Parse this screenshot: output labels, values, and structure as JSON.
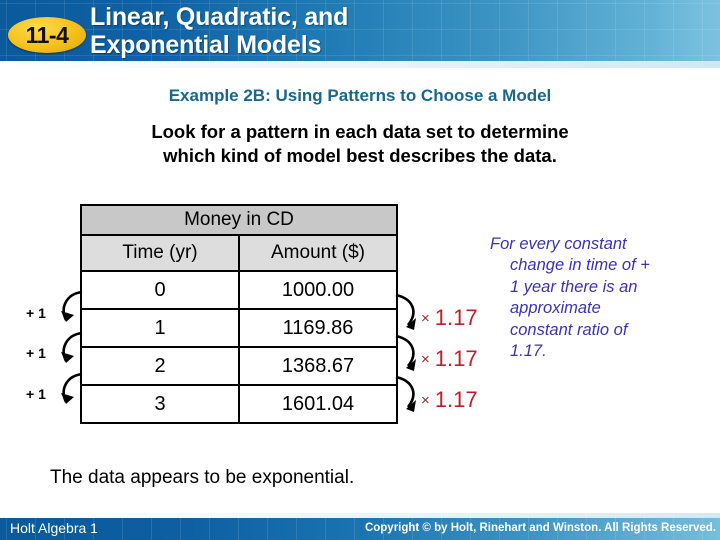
{
  "header": {
    "badge_label": "11-4",
    "title_line1": "Linear, Quadratic, and",
    "title_line2": "Exponential Models"
  },
  "example": {
    "heading": "Example 2B: Using Patterns to Choose a Model",
    "instruction_line1": "Look for a pattern in each data set to determine",
    "instruction_line2": "which kind of model best describes the data."
  },
  "table": {
    "title": "Money in CD",
    "columns": [
      "Time (yr)",
      "Amount ($)"
    ],
    "rows": [
      {
        "time": "0",
        "amount": "1000.00"
      },
      {
        "time": "1",
        "amount": "1169.86"
      },
      {
        "time": "2",
        "amount": "1368.67"
      },
      {
        "time": "3",
        "amount": "1601.04"
      }
    ]
  },
  "annotations": {
    "left_deltas": [
      "+ 1",
      "+ 1",
      "+ 1"
    ],
    "right_times_symbol": "×",
    "right_ratios": [
      "1.17",
      "1.17",
      "1.17"
    ]
  },
  "explanation": {
    "line1": "For every constant",
    "line2": "change in time of +",
    "line3": "1 year there is an",
    "line4": "approximate",
    "line5": "constant ratio of",
    "line6": "1.17."
  },
  "conclusion": {
    "text": "The data appears to be exponential."
  },
  "footer": {
    "left": "Holt Algebra 1",
    "right": "Copyright © by Holt, Rinehart and Winston. All Rights Reserved."
  },
  "colors": {
    "banner_dark": "#0a5a9c",
    "banner_light": "#7cc2e0",
    "badge": "#f5c01c",
    "example_heading": "#17678f",
    "ratio_red": "#bf2025",
    "times_red": "#9e2a2a",
    "explanation_blue": "#3a33b5",
    "table_title_bg": "#c8c8c8",
    "table_head_bg": "#dddddd"
  },
  "chart_data": {
    "type": "table",
    "title": "Money in CD",
    "categories": [
      "0",
      "1",
      "2",
      "3"
    ],
    "xlabel": "Time (yr)",
    "ylabel": "Amount ($)",
    "values": [
      1000.0,
      1169.86,
      1368.67,
      1601.04
    ],
    "first_differences_x": [
      1,
      1,
      1
    ],
    "ratios_y": [
      1.17,
      1.17,
      1.17
    ],
    "conclusion": "The data appears to be exponential."
  }
}
